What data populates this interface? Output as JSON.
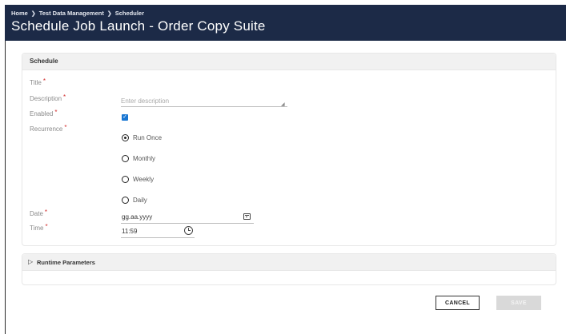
{
  "breadcrumb": {
    "items": [
      "Home",
      "Test Data Management",
      "Scheduler"
    ],
    "separator": "❯"
  },
  "page": {
    "title": "Schedule Job Launch - Order Copy Suite"
  },
  "schedule": {
    "section_title": "Schedule",
    "fields": {
      "title_label": "Title",
      "description_label": "Description",
      "description_placeholder": "Enter description",
      "enabled_label": "Enabled",
      "enabled_checked": true,
      "recurrence_label": "Recurrence",
      "date_label": "Date",
      "date_value": "gg.aa.yyyy",
      "time_label": "Time",
      "time_value": "11:59"
    },
    "required_marker": "*",
    "recurrence_options": [
      {
        "label": "Run Once",
        "selected": true
      },
      {
        "label": "Monthly",
        "selected": false
      },
      {
        "label": "Weekly",
        "selected": false
      },
      {
        "label": "Daily",
        "selected": false
      }
    ]
  },
  "runtime": {
    "section_title": "Runtime Parameters",
    "expand_icon": "▷"
  },
  "actions": {
    "cancel_label": "CANCEL",
    "save_label": "SAVE"
  },
  "colors": {
    "header_bg": "#1c2a47",
    "accent": "#1976d2",
    "required": "#d32f2f",
    "save_disabled": "#d9d9d9"
  }
}
